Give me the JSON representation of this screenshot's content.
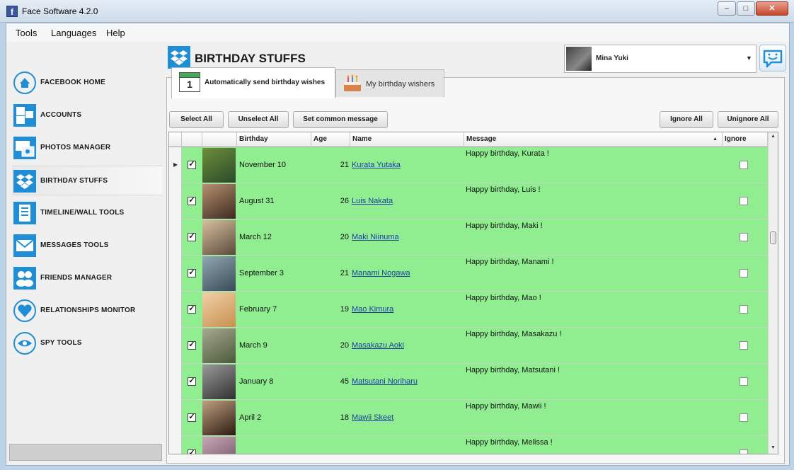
{
  "window": {
    "title": "Face Software 4.2.0",
    "app_icon": "f",
    "min": "–",
    "max": "□",
    "close": "✕"
  },
  "menu": [
    "Tools",
    "Languages",
    "Help"
  ],
  "sidebar": [
    {
      "label": "FACEBOOK HOME",
      "icon": "home-icon"
    },
    {
      "label": "ACCOUNTS",
      "icon": "accounts-icon"
    },
    {
      "label": "PHOTOS MANAGER",
      "icon": "photos-icon"
    },
    {
      "label": "BIRTHDAY STUFFS",
      "icon": "dropbox-icon",
      "active": true
    },
    {
      "label": "TIMELINE/WALL TOOLS",
      "icon": "timeline-icon"
    },
    {
      "label": "MESSAGES TOOLS",
      "icon": "envelope-icon"
    },
    {
      "label": "FRIENDS MANAGER",
      "icon": "friends-icon"
    },
    {
      "label": "RELATIONSHIPS MONITOR",
      "icon": "heart-icon"
    },
    {
      "label": "SPY TOOLS",
      "icon": "eye-icon"
    }
  ],
  "header": {
    "title": "BIRTHDAY STUFFS",
    "user_name": "Mina Yuki"
  },
  "tabs": [
    {
      "label": "Automatically send birthday wishes",
      "icon_text": "1"
    },
    {
      "label": "My birthday wishers"
    }
  ],
  "toolbar": {
    "select_all": "Select All",
    "unselect_all": "Unselect All",
    "set_common": "Set common message",
    "ignore_all": "Ignore All",
    "unignore_all": "Unignore All"
  },
  "grid": {
    "columns": [
      "Birthday",
      "Age",
      "Name",
      "Message",
      "Ignore"
    ],
    "sort_column": "Message",
    "row_color": "#90ee90",
    "rows": [
      {
        "birthday": "November 10",
        "age": "21",
        "name": "Kurata Yutaka",
        "message": "Happy birthday, Kurata !",
        "checked": "✓",
        "photo": [
          "#2a4a2a",
          "#6e8f3a"
        ]
      },
      {
        "birthday": "August 31",
        "age": "26",
        "name": "Luis Nakata",
        "message": "Happy birthday, Luis !",
        "checked": "✓",
        "photo": [
          "#3a2a20",
          "#b89070"
        ]
      },
      {
        "birthday": "March 12",
        "age": "20",
        "name": "Maki Niinuma",
        "message": "Happy birthday, Maki !",
        "checked": "✓",
        "photo": [
          "#5a4a3a",
          "#d8c0a0"
        ]
      },
      {
        "birthday": "September 3",
        "age": "21",
        "name": "Manami Nogawa",
        "message": "Happy birthday, Manami !",
        "checked": "✓",
        "photo": [
          "#3a4a5a",
          "#90a8b0"
        ]
      },
      {
        "birthday": "February 7",
        "age": "19",
        "name": "Mao Kimura",
        "message": "Happy birthday, Mao !",
        "checked": "✓",
        "photo": [
          "#c89050",
          "#f0d0a8"
        ]
      },
      {
        "birthday": "March 9",
        "age": "20",
        "name": "Masakazu Aoki",
        "message": "Happy birthday, Masakazu !",
        "checked": "✓",
        "photo": [
          "#4a5a3a",
          "#a8a890"
        ]
      },
      {
        "birthday": "January 8",
        "age": "45",
        "name": "Matsutani Noriharu",
        "message": "Happy birthday, Matsutani !",
        "checked": "✓",
        "photo": [
          "#303030",
          "#9a9a9a"
        ]
      },
      {
        "birthday": "April 2",
        "age": "18",
        "name": "Mawii Skeet",
        "message": "Happy birthday, Mawii !",
        "checked": "✓",
        "photo": [
          "#2a1a10",
          "#c0a080"
        ]
      },
      {
        "birthday": "",
        "age": "",
        "name": "",
        "message": "Happy birthday, Melissa !",
        "checked": "✓",
        "photo": [
          "#6a4a5a",
          "#c8a8b8"
        ]
      }
    ]
  }
}
